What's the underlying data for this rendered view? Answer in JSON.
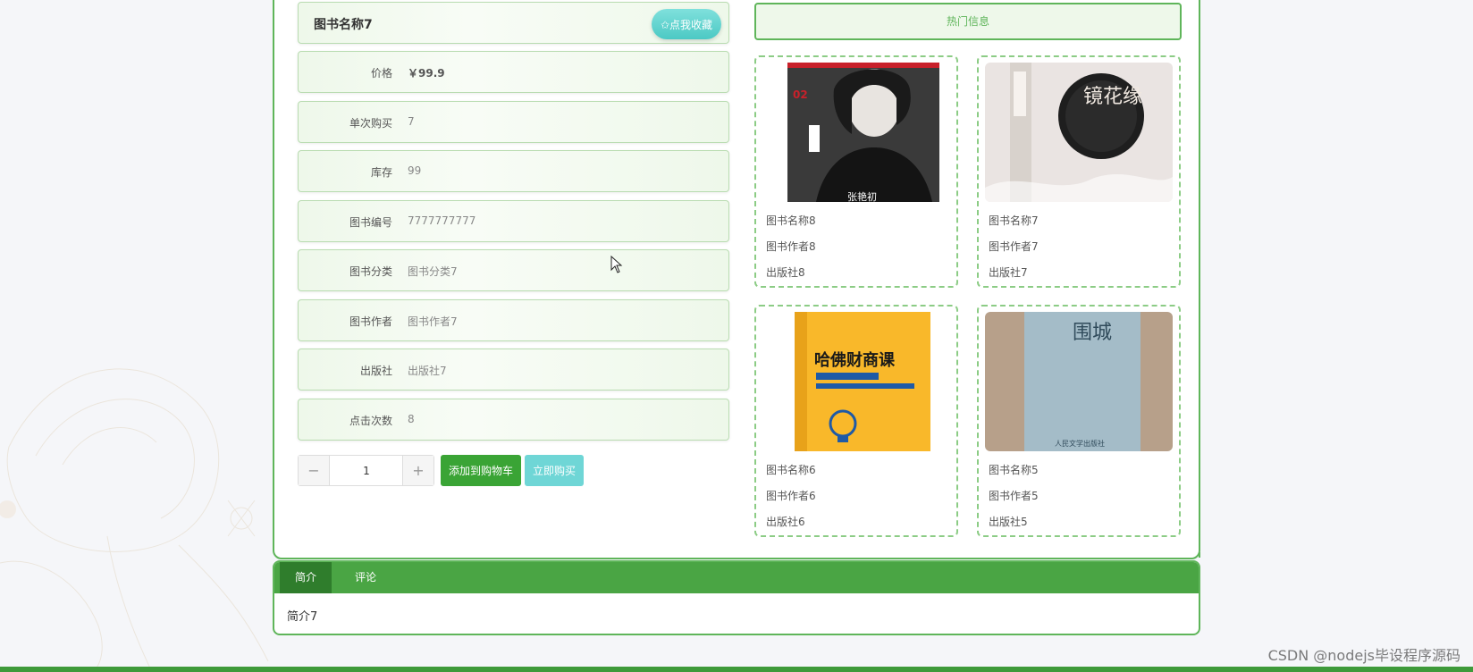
{
  "book": {
    "title": "图书名称7",
    "favorite_label": "✩点我收藏",
    "fields": [
      {
        "label": "价格",
        "value": "￥99.9"
      },
      {
        "label": "单次购买",
        "value": "7"
      },
      {
        "label": "库存",
        "value": "99"
      },
      {
        "label": "图书编号",
        "value": "7777777777"
      },
      {
        "label": "图书分类",
        "value": "图书分类7"
      },
      {
        "label": "图书作者",
        "value": "图书作者7"
      },
      {
        "label": "出版社",
        "value": "出版社7"
      },
      {
        "label": "点击次数",
        "value": "8"
      }
    ]
  },
  "purchase": {
    "minus": "−",
    "plus": "+",
    "quantity": "1",
    "add_to_cart": "添加到购物车",
    "buy_now": "立即购买"
  },
  "hot": {
    "header": "热门信息",
    "cards": [
      {
        "name": "图书名称8",
        "author": "图书作者8",
        "publisher": "出版社8",
        "cover_text": "张艳初",
        "cover_badge": "02"
      },
      {
        "name": "图书名称7",
        "author": "图书作者7",
        "publisher": "出版社7",
        "cover_text": "镜花缘"
      },
      {
        "name": "图书名称6",
        "author": "图书作者6",
        "publisher": "出版社6",
        "cover_text": "哈佛财商课"
      },
      {
        "name": "图书名称5",
        "author": "图书作者5",
        "publisher": "出版社5",
        "cover_text": "围城",
        "cover_sub": "人民文学出版社"
      }
    ]
  },
  "tabs": {
    "items": [
      "简介",
      "评论"
    ],
    "content": "简介7"
  },
  "watermark": "CSDN @nodejs毕设程序源码"
}
